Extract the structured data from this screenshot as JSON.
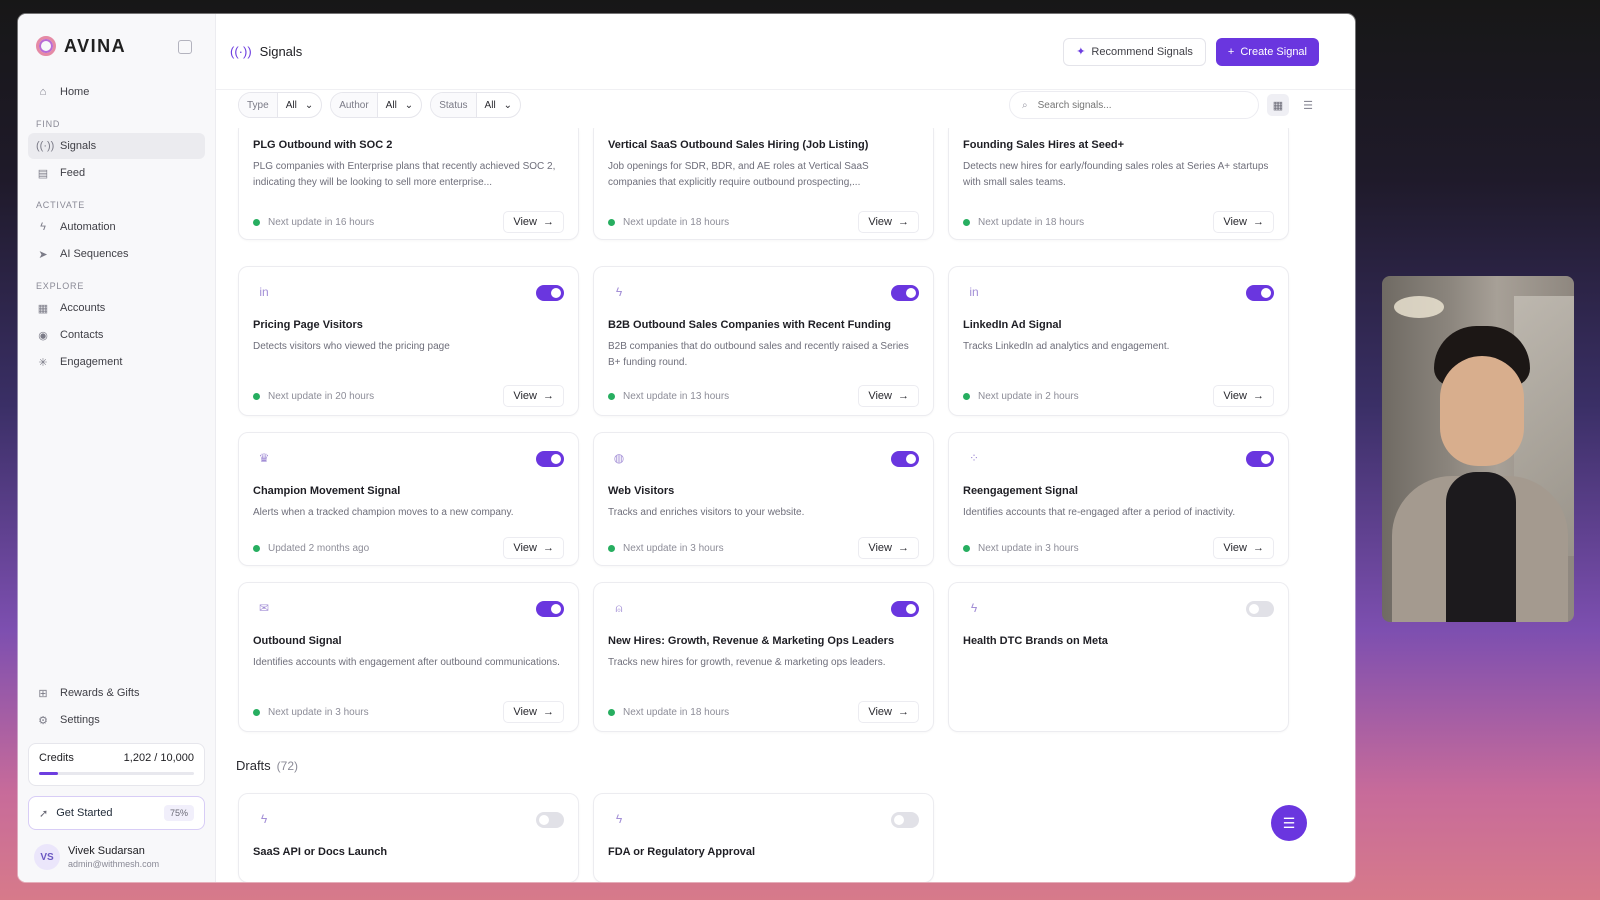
{
  "brand": {
    "name": "AVINA"
  },
  "sidebar": {
    "home": "Home",
    "sections": {
      "find": "FIND",
      "activate": "ACTIVATE",
      "explore": "EXPLORE"
    },
    "find_items": [
      {
        "label": "Signals",
        "icon": "signal-icon"
      },
      {
        "label": "Feed",
        "icon": "feed-icon"
      }
    ],
    "activate_items": [
      {
        "label": "Automation",
        "icon": "bolt-icon"
      },
      {
        "label": "AI Sequences",
        "icon": "send-icon"
      }
    ],
    "explore_items": [
      {
        "label": "Accounts",
        "icon": "building-icon"
      },
      {
        "label": "Contacts",
        "icon": "contact-icon"
      },
      {
        "label": "Engagement",
        "icon": "sparkle-icon"
      }
    ],
    "bottom_items": [
      {
        "label": "Rewards & Gifts",
        "icon": "gift-icon"
      },
      {
        "label": "Settings",
        "icon": "gear-icon"
      }
    ],
    "credits": {
      "label": "Credits",
      "value": "1,202 / 10,000",
      "fraction": 0.1202
    },
    "get_started": {
      "label": "Get Started",
      "percent": "75%"
    },
    "user": {
      "initials": "VS",
      "name": "Vivek Sudarsan",
      "email": "admin@withmesh.com"
    }
  },
  "header": {
    "title": "Signals",
    "recommend": "Recommend Signals",
    "create": "Create Signal"
  },
  "filters": [
    {
      "label": "Type",
      "value": "All"
    },
    {
      "label": "Author",
      "value": "All"
    },
    {
      "label": "Status",
      "value": "All"
    }
  ],
  "search": {
    "placeholder": "Search signals..."
  },
  "view_label": "View",
  "drafts": {
    "label": "Drafts",
    "count": "(72)"
  },
  "cards": [
    {
      "title": "PLG Outbound with SOC 2",
      "desc": "PLG companies with Enterprise plans that recently achieved SOC 2, indicating they will be looking to sell more enterprise...",
      "status": "Next update in 16 hours",
      "icon": "",
      "toggle": true
    },
    {
      "title": "Vertical SaaS Outbound Sales Hiring (Job Listing)",
      "desc": "Job openings for SDR, BDR, and AE roles at Vertical SaaS companies that explicitly require outbound prospecting,...",
      "status": "Next update in 18 hours",
      "icon": "",
      "toggle": true
    },
    {
      "title": "Founding Sales Hires at Seed+",
      "desc": "Detects new hires for early/founding sales roles at Series A+ startups with small sales teams.",
      "status": "Next update in 18 hours",
      "icon": "",
      "toggle": true
    },
    {
      "title": "Pricing Page Visitors",
      "desc": "Detects visitors who viewed the pricing page",
      "status": "Next update in 20 hours",
      "icon": "linkedin-icon",
      "toggle": true
    },
    {
      "title": "B2B Outbound Sales Companies with Recent Funding",
      "desc": "B2B companies that do outbound sales and recently raised a Series B+ funding round.",
      "status": "Next update in 13 hours",
      "icon": "bolt-icon",
      "toggle": true
    },
    {
      "title": "LinkedIn Ad Signal",
      "desc": "Tracks LinkedIn ad analytics and engagement.",
      "status": "Next update in 2 hours",
      "icon": "linkedin-icon",
      "toggle": true
    },
    {
      "title": "Champion Movement Signal",
      "desc": "Alerts when a tracked champion moves to a new company.",
      "status": "Updated 2 months ago",
      "icon": "crown-icon",
      "toggle": true
    },
    {
      "title": "Web Visitors",
      "desc": "Tracks and enriches visitors to your website.",
      "status": "Next update in 3 hours",
      "icon": "globe-icon",
      "toggle": true
    },
    {
      "title": "Reengagement Signal",
      "desc": "Identifies accounts that re-engaged after a period of inactivity.",
      "status": "Next update in 3 hours",
      "icon": "grid-icon",
      "toggle": true
    },
    {
      "title": "Outbound Signal",
      "desc": "Identifies accounts with engagement after outbound communications.",
      "status": "Next update in 3 hours",
      "icon": "mail-icon",
      "toggle": true
    },
    {
      "title": "New Hires: Growth, Revenue & Marketing Ops Leaders",
      "desc": "Tracks new hires for growth, revenue & marketing ops leaders.",
      "status": "Next update in 18 hours",
      "icon": "user-plus-icon",
      "toggle": true
    },
    {
      "title": "Health DTC Brands on Meta",
      "desc": "",
      "status": "",
      "icon": "bolt-icon",
      "toggle": false
    },
    {
      "title": "SaaS API or Docs Launch",
      "desc": "",
      "status": "",
      "icon": "bolt-icon",
      "toggle": false
    },
    {
      "title": "FDA or Regulatory Approval",
      "desc": "",
      "status": "",
      "icon": "bolt-icon",
      "toggle": false
    }
  ]
}
